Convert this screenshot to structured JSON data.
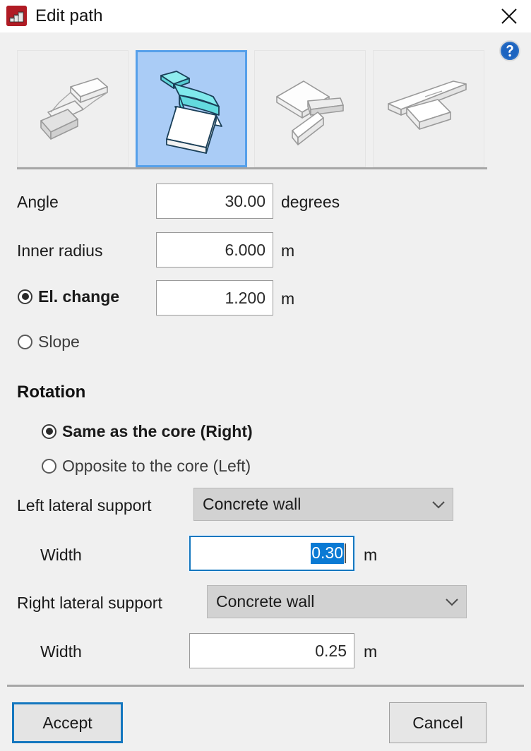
{
  "window": {
    "title": "Edit path",
    "app_icon": "stairs-icon",
    "close_icon": "close-icon",
    "help_icon": "help-icon"
  },
  "path_types": {
    "options": [
      {
        "name": "straight-flight-path",
        "label": "Straight flight",
        "selected": false
      },
      {
        "name": "curved-winder-path",
        "label": "Curved winder",
        "selected": true
      },
      {
        "name": "tee-landing-path",
        "label": "T-shaped landing",
        "selected": false
      },
      {
        "name": "crossing-flat-path",
        "label": "Crossing flat path",
        "selected": false
      }
    ]
  },
  "fields": {
    "angle": {
      "label": "Angle",
      "value": "30.00",
      "unit": "degrees"
    },
    "inner_radius": {
      "label": "Inner radius",
      "value": "6.000",
      "unit": "m"
    },
    "el_change": {
      "label": "El. change",
      "value": "1.200",
      "unit": "m",
      "selected": true
    },
    "slope": {
      "label": "Slope",
      "selected": false
    }
  },
  "rotation": {
    "title": "Rotation",
    "options": [
      {
        "label": "Same as the core (Right)",
        "selected": true
      },
      {
        "label": "Opposite to the core (Left)",
        "selected": false
      }
    ]
  },
  "left_support": {
    "label": "Left lateral support",
    "value": "Concrete wall",
    "width_label": "Width",
    "width_value": "0.30",
    "width_unit": "m",
    "width_focused": true
  },
  "right_support": {
    "label": "Right lateral support",
    "value": "Concrete wall",
    "width_label": "Width",
    "width_value": "0.25",
    "width_unit": "m",
    "width_focused": false
  },
  "footer": {
    "accept_label": "Accept",
    "cancel_label": "Cancel"
  },
  "colors": {
    "accent_blue": "#1477bf",
    "selection_blue": "#0a7ad4",
    "selected_tile_bg": "#aaccf6",
    "selected_tile_border": "#56a0ea",
    "app_icon_red": "#b01b24",
    "dialog_bg": "#f0f0f0",
    "illustration_cyan": "#79efe8"
  }
}
